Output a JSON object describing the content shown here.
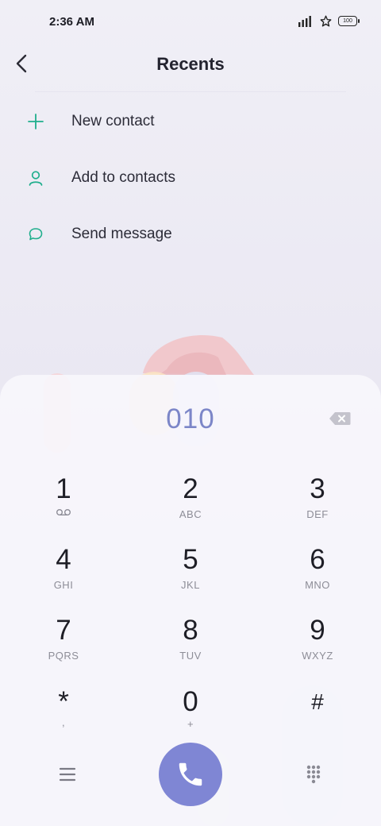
{
  "status_bar": {
    "time": "2:36 AM",
    "battery": "100",
    "icons": [
      "signal-icon",
      "star-icon",
      "battery-icon"
    ]
  },
  "header": {
    "title": "Recents",
    "back_icon": "back-arrow-icon"
  },
  "menu": [
    {
      "label": "New contact",
      "icon": "plus-icon"
    },
    {
      "label": "Add to contacts",
      "icon": "person-icon"
    },
    {
      "label": "Send message",
      "icon": "chat-bubble-icon"
    }
  ],
  "dialer": {
    "number": "010",
    "keys": [
      {
        "digit": "1",
        "letters": ""
      },
      {
        "digit": "2",
        "letters": "ABC"
      },
      {
        "digit": "3",
        "letters": "DEF"
      },
      {
        "digit": "4",
        "letters": "GHI"
      },
      {
        "digit": "5",
        "letters": "JKL"
      },
      {
        "digit": "6",
        "letters": "MNO"
      },
      {
        "digit": "7",
        "letters": "PQRS"
      },
      {
        "digit": "8",
        "letters": "TUV"
      },
      {
        "digit": "9",
        "letters": "WXYZ"
      },
      {
        "digit": "*",
        "letters": ","
      },
      {
        "digit": "0",
        "letters": "+"
      },
      {
        "digit": "#",
        "letters": ""
      }
    ]
  },
  "colors": {
    "accent": "#7f86d4",
    "number": "#7c86c8",
    "icon_green": "#1fae8c"
  }
}
